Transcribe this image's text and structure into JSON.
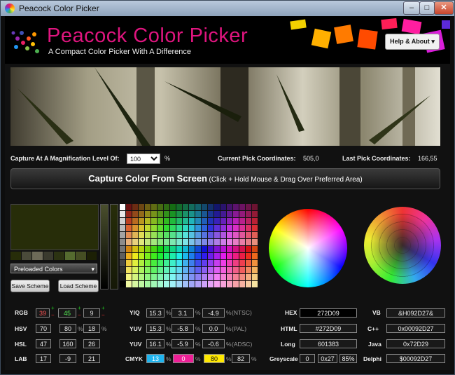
{
  "window": {
    "title": "Peacock Color Picker",
    "controls": [
      "–",
      "□",
      "✕"
    ]
  },
  "header": {
    "title": "Peacock Color Picker",
    "subtitle": "A Compact Color Picker With A Difference",
    "help_button": "Help & About",
    "palette_colors": [
      "#f2d100",
      "#ffb000",
      "#ff7b00",
      "#ff4b00",
      "#ff1e57",
      "#ff1ea0",
      "#d81ed8",
      "#5b2ad8"
    ]
  },
  "capture": {
    "magnification_label": "Capture At A Magnification Level Of:",
    "magnification_value": "100",
    "percent": "%",
    "current_label": "Current Pick Coordinates:",
    "current_value": "505,0",
    "last_label": "Last Pick Coordinates:",
    "last_value": "166,55",
    "button_main": "Capture Color From Screen",
    "button_hint": "(Click + Hold Mouse & Drag Over Preferred Area)"
  },
  "swatches": {
    "current_color": "#272D09",
    "scheme": [
      "#272d09",
      "#4a4a3a",
      "#6d6a58",
      "#3a3a2e",
      "#2c3312",
      "#556b2f",
      "#454e23",
      "#1c2005"
    ],
    "preloaded_label": "Preloaded Colors",
    "save_label": "Save Scheme",
    "load_label": "Load Scheme"
  },
  "values": {
    "rgb": {
      "label": "RGB",
      "r": "39",
      "g": "45",
      "b": "9"
    },
    "hsv": {
      "label": "HSV",
      "h": "70",
      "s": "80",
      "v": "18"
    },
    "hsl": {
      "label": "HSL",
      "h": "47",
      "s": "160",
      "l": "26"
    },
    "lab": {
      "label": "LAB",
      "l": "17",
      "a": "-9",
      "b": "21"
    },
    "yiq": {
      "label": "YIQ",
      "a": "15.3",
      "b": "3.1",
      "c": "-4.9",
      "note": "(NTSC)"
    },
    "yuv1": {
      "label": "YUV",
      "a": "15.3",
      "b": "-5.8",
      "c": "0.0",
      "note": "(PAL)"
    },
    "yuv2": {
      "label": "YUV",
      "a": "16.1",
      "b": "-5.9",
      "c": "-0.6",
      "note": "(ADSC)"
    },
    "cmyk": {
      "label": "CMYK",
      "c": "13",
      "m": "0",
      "y": "80",
      "k": "82"
    },
    "hex": {
      "label": "HEX",
      "value": "272D09"
    },
    "html": {
      "label": "HTML",
      "value": "#272D09"
    },
    "long": {
      "label": "Long",
      "value": "601383"
    },
    "greyscale": {
      "label": "Greyscale",
      "a": "0",
      "b": "0x27",
      "c": "85%"
    },
    "vb": {
      "label": "VB",
      "value": "&H092D27&"
    },
    "cpp": {
      "label": "C++",
      "value": "0x00092D27"
    },
    "java": {
      "label": "Java",
      "value": "0x72D29"
    },
    "delphi": {
      "label": "Delphi",
      "value": "$00092D27"
    },
    "percent": "%"
  }
}
